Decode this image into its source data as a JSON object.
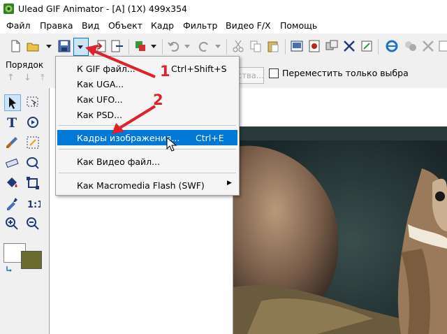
{
  "window": {
    "title": "Ulead GIF Animator - [A] (1X) 499x354"
  },
  "menubar": {
    "items": [
      "Файл",
      "Правка",
      "Вид",
      "Объект",
      "Кадр",
      "Фильтр",
      "Видео F/X",
      "Помощь"
    ]
  },
  "options_bar": {
    "order_label": "Порядок",
    "hidden_button_label": "ства...",
    "move_only_checkbox_label": "Переместить только выбра"
  },
  "dropdown": {
    "items": [
      {
        "label": "К GIF файл...",
        "shortcut": "Ctrl+Shift+S"
      },
      {
        "label": "Как UGA...",
        "shortcut": ""
      },
      {
        "label": "Как UFO...",
        "shortcut": ""
      },
      {
        "label": "Как PSD...",
        "shortcut": ""
      },
      {
        "label": "Кадры изображения...",
        "shortcut": "Ctrl+E",
        "highlighted": true
      },
      {
        "label": "Как Видео файл...",
        "shortcut": ""
      },
      {
        "label": "Как Macromedia Flash (SWF)",
        "shortcut": "",
        "submenu": true
      }
    ]
  },
  "annotations": {
    "marker_1": "1",
    "marker_2": "2",
    "color": "#e0202a"
  },
  "tool_panel": {
    "foreground_color": "#ffffff",
    "background_color": "#6b6b2e"
  },
  "colors": {
    "highlight": "#0078d7"
  }
}
